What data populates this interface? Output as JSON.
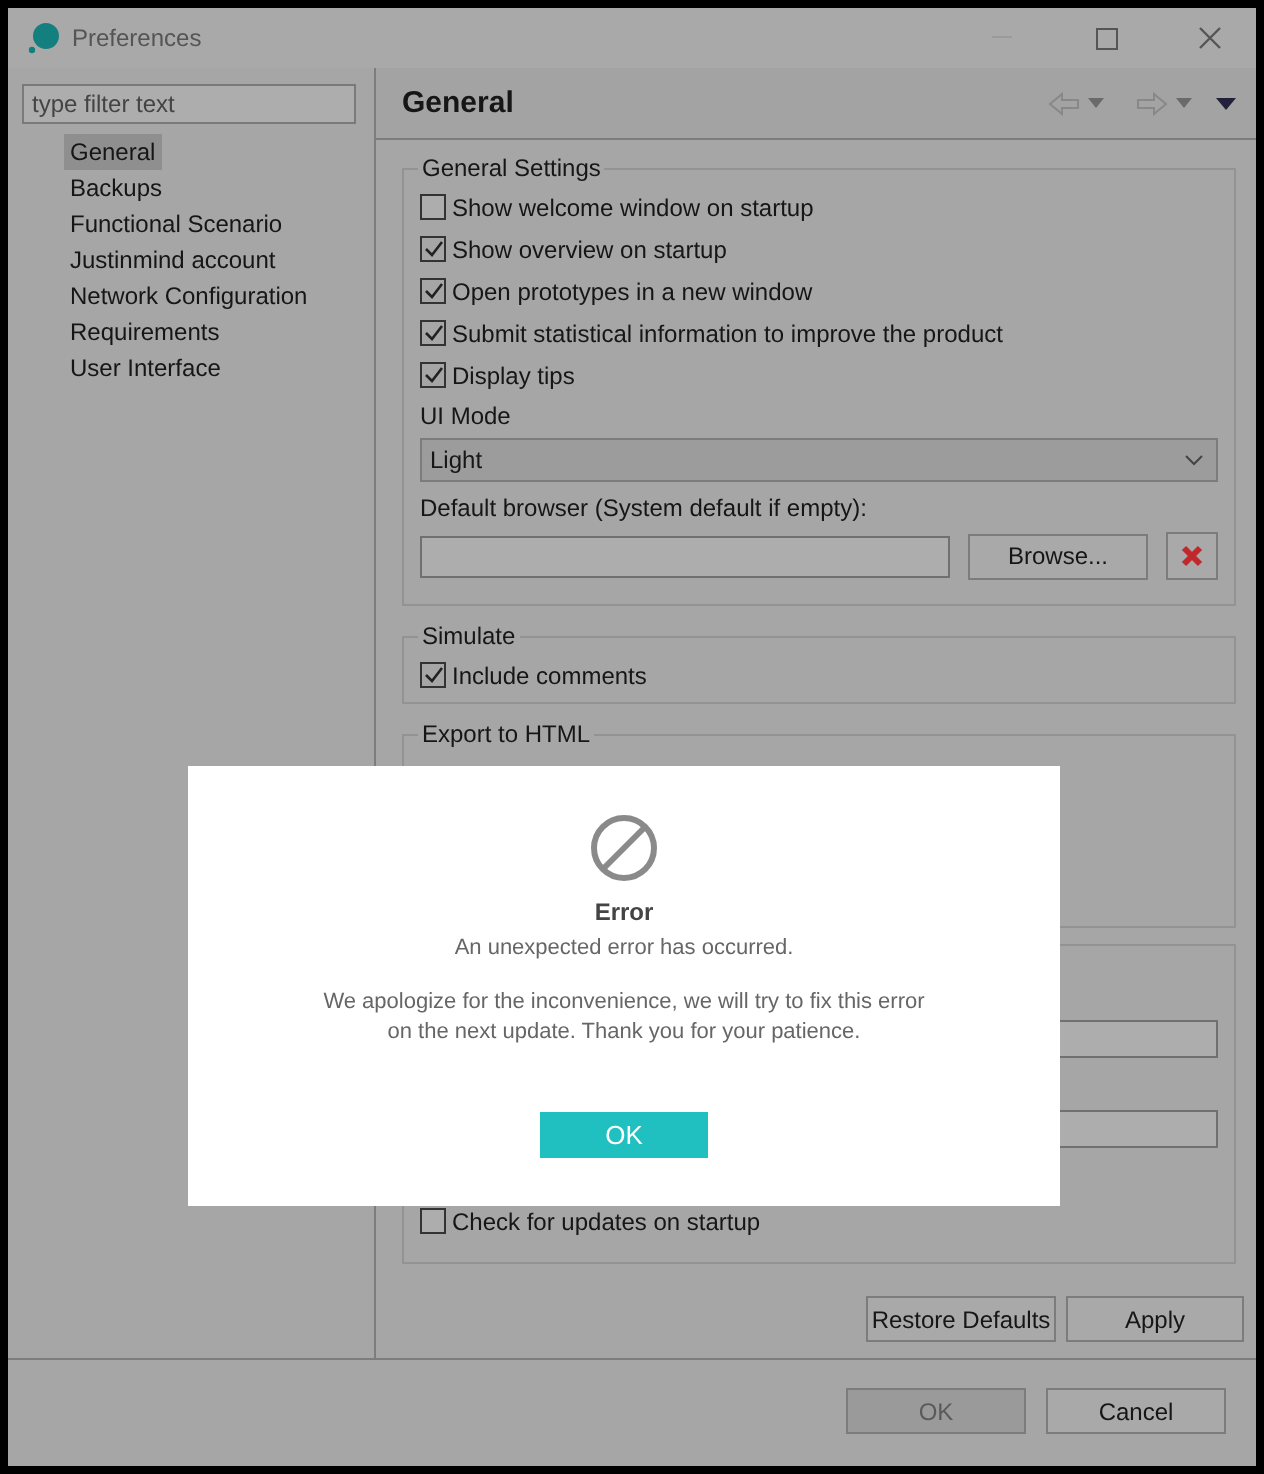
{
  "window": {
    "title": "Preferences"
  },
  "filter": {
    "placeholder": "type filter text"
  },
  "nav": [
    {
      "label": "General",
      "selected": true
    },
    {
      "label": "Backups",
      "selected": false
    },
    {
      "label": "Functional Scenario",
      "selected": false
    },
    {
      "label": "Justinmind account",
      "selected": false
    },
    {
      "label": "Network Configuration",
      "selected": false
    },
    {
      "label": "Requirements",
      "selected": false
    },
    {
      "label": "User Interface",
      "selected": false
    }
  ],
  "page": {
    "title": "General"
  },
  "general_settings": {
    "title": "General Settings",
    "options": [
      {
        "label": "Show welcome window on startup",
        "checked": false
      },
      {
        "label": "Show overview on startup",
        "checked": true
      },
      {
        "label": "Open prototypes in a new window",
        "checked": true
      },
      {
        "label": "Submit statistical information to improve the product",
        "checked": true
      },
      {
        "label": "Display tips",
        "checked": true
      }
    ],
    "ui_mode": {
      "label": "UI Mode",
      "value": "Light"
    },
    "default_browser": {
      "label": "Default browser (System default if empty):",
      "browse": "Browse..."
    }
  },
  "simulate": {
    "title": "Simulate",
    "options": [
      {
        "label": "Include comments",
        "checked": true
      }
    ]
  },
  "export_html": {
    "title": "Export to HTML"
  },
  "updates": {
    "options": [
      {
        "label": "Check for updates on startup",
        "checked": false
      }
    ]
  },
  "page_buttons": [
    "Restore Defaults",
    "Apply"
  ],
  "dialog_buttons": [
    {
      "label": "OK",
      "disabled": true
    },
    {
      "label": "Cancel",
      "disabled": false
    }
  ],
  "error_dialog": {
    "title": "Error",
    "message": "An unexpected error has occurred.",
    "details": "We apologize for the inconvenience, we will try to fix this error\non the next update. Thank you for your patience.",
    "button": "OK"
  }
}
